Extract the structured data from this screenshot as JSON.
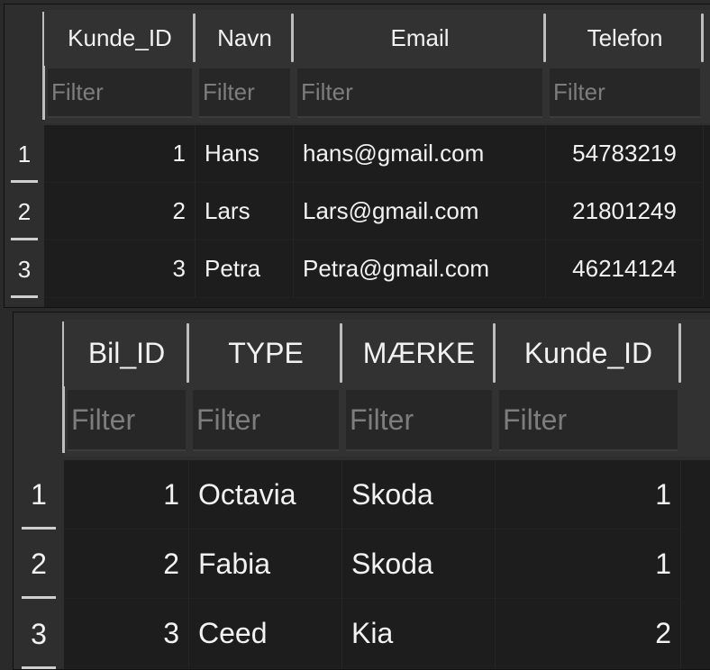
{
  "tables": [
    {
      "name": "kunde-table",
      "columns": [
        "Kunde_ID",
        "Navn",
        "Email",
        "Telefon"
      ],
      "filter_placeholder": "Filter",
      "numeric_columns": [
        0
      ],
      "row_numbers": [
        "1",
        "2",
        "3"
      ],
      "rows": [
        [
          "1",
          "Hans",
          "hans@gmail.com",
          "54783219"
        ],
        [
          "2",
          "Lars",
          "Lars@gmail.com",
          "21801249"
        ],
        [
          "3",
          "Petra",
          "Petra@gmail.com",
          "46214124"
        ]
      ]
    },
    {
      "name": "bil-table",
      "columns": [
        "Bil_ID",
        "TYPE",
        "MÆRKE",
        "Kunde_ID"
      ],
      "filter_placeholder": "Filter",
      "numeric_columns": [
        0,
        3
      ],
      "row_numbers": [
        "1",
        "2",
        "3"
      ],
      "rows": [
        [
          "1",
          "Octavia",
          "Skoda",
          "1"
        ],
        [
          "2",
          "Fabia",
          "Skoda",
          "1"
        ],
        [
          "3",
          "Ceed",
          "Kia",
          "2"
        ]
      ]
    }
  ]
}
